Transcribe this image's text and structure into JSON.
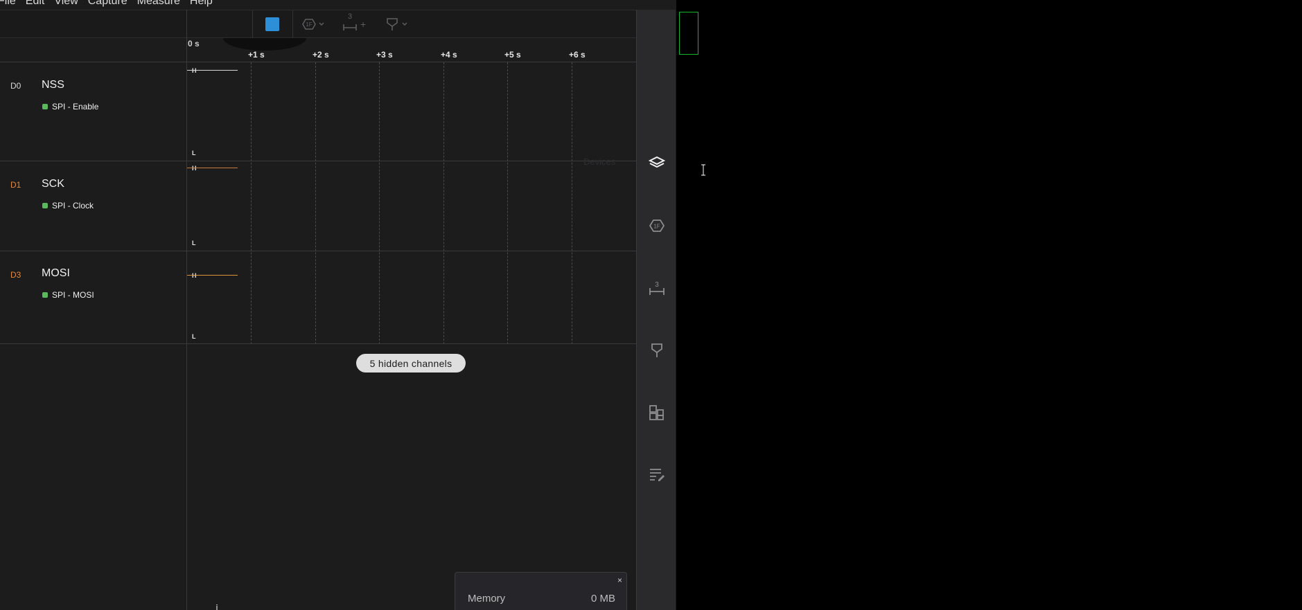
{
  "menu": [
    "File",
    "Edit",
    "View",
    "Capture",
    "Measure",
    "Help"
  ],
  "toolbar": {
    "icons": [
      "stop-icon",
      "trigger-icon",
      "measure-icon",
      "marker-icon"
    ],
    "measure_badge": "3",
    "measure_add": "+"
  },
  "ruler": {
    "zero_label": "0 s",
    "ticks": [
      "+1 s",
      "+2 s",
      "+3 s",
      "+4 s",
      "+5 s",
      "+6 s"
    ]
  },
  "channels": [
    {
      "id": "D0",
      "name": "NSS",
      "tag": "SPI - Enable",
      "id_color": "#d8d8d8",
      "signal_color": "#d8d8d8",
      "high": "H",
      "low": "L"
    },
    {
      "id": "D1",
      "name": "SCK",
      "tag": "SPI - Clock",
      "id_color": "#e38a3c",
      "signal_color": "#c87c3e",
      "high": "H",
      "low": "L"
    },
    {
      "id": "D3",
      "name": "MOSI",
      "tag": "SPI - MOSI",
      "id_color": "#e38a3c",
      "signal_color": "#e0923e",
      "high": "H",
      "low": "L"
    }
  ],
  "hidden_channels_label": "5 hidden channels",
  "devices_ghost": "Devices",
  "sidebar": {
    "icons": [
      "devices-icon",
      "analyzers-icon",
      "measurements-icon",
      "timing-markers-icon",
      "extensions-icon",
      "notes-icon"
    ]
  },
  "memory": {
    "label": "Memory",
    "value": "0 MB",
    "close": "×"
  },
  "colors": {
    "accent": "#2e8fd9",
    "channel_tag": "#5cb85c",
    "selection": "#19b22e"
  }
}
